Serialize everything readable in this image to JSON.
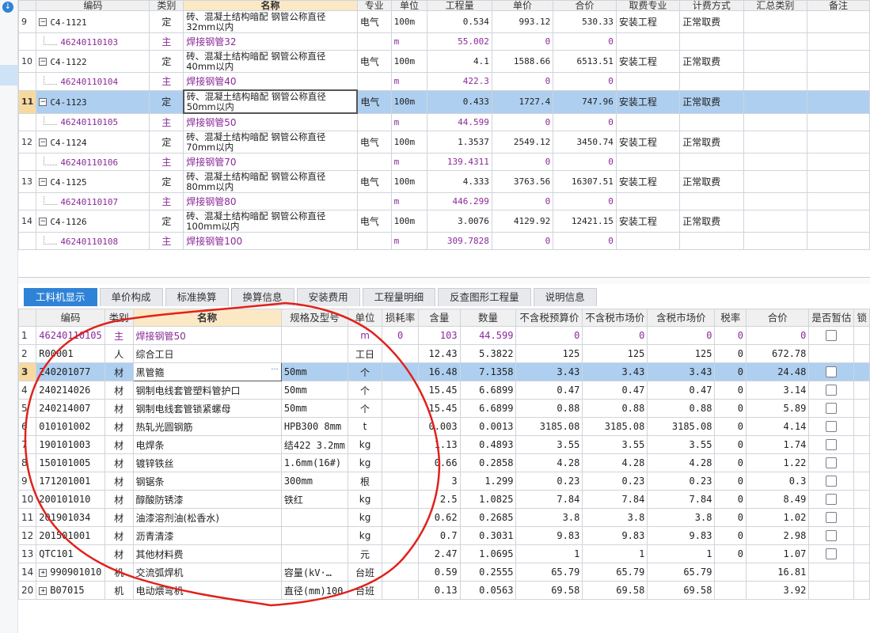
{
  "top_table": {
    "headers": [
      "",
      "编码",
      "类别",
      "名称",
      "专业",
      "单位",
      "工程量",
      "单价",
      "合价",
      "取费专业",
      "计费方式",
      "汇总类别",
      "备注"
    ],
    "rows": [
      {
        "no": "9",
        "code": "C4-1121",
        "type": "定",
        "name": "砖、混凝土结构暗配 钢管公称直径32mm以内",
        "spec": "电气",
        "unit": "100m",
        "qty": "0.534",
        "price": "993.12",
        "total": "530.33",
        "fee": "安装工程",
        "method": "正常取费",
        "sub": {
          "code": "46240110103",
          "type": "主",
          "name": "焊接钢管32",
          "unit": "m",
          "qty": "55.002",
          "price": "0",
          "total": "0"
        }
      },
      {
        "no": "10",
        "code": "C4-1122",
        "type": "定",
        "name": "砖、混凝土结构暗配 钢管公称直径40mm以内",
        "spec": "电气",
        "unit": "100m",
        "qty": "4.1",
        "price": "1588.66",
        "total": "6513.51",
        "fee": "安装工程",
        "method": "正常取费",
        "sub": {
          "code": "46240110104",
          "type": "主",
          "name": "焊接钢管40",
          "unit": "m",
          "qty": "422.3",
          "price": "0",
          "total": "0"
        }
      },
      {
        "no": "11",
        "code": "C4-1123",
        "type": "定",
        "name": "砖、混凝土结构暗配 钢管公称直径50mm以内",
        "spec": "电气",
        "unit": "100m",
        "qty": "0.433",
        "price": "1727.4",
        "total": "747.96",
        "fee": "安装工程",
        "method": "正常取费",
        "selected": true,
        "sub": {
          "code": "46240110105",
          "type": "主",
          "name": "焊接钢管50",
          "unit": "m",
          "qty": "44.599",
          "price": "0",
          "total": "0"
        }
      },
      {
        "no": "12",
        "code": "C4-1124",
        "type": "定",
        "name": "砖、混凝土结构暗配 钢管公称直径70mm以内",
        "spec": "电气",
        "unit": "100m",
        "qty": "1.3537",
        "price": "2549.12",
        "total": "3450.74",
        "fee": "安装工程",
        "method": "正常取费",
        "sub": {
          "code": "46240110106",
          "type": "主",
          "name": "焊接钢管70",
          "unit": "m",
          "qty": "139.4311",
          "price": "0",
          "total": "0"
        }
      },
      {
        "no": "13",
        "code": "C4-1125",
        "type": "定",
        "name": "砖、混凝土结构暗配 钢管公称直径80mm以内",
        "spec": "电气",
        "unit": "100m",
        "qty": "4.333",
        "price": "3763.56",
        "total": "16307.51",
        "fee": "安装工程",
        "method": "正常取费",
        "sub": {
          "code": "46240110107",
          "type": "主",
          "name": "焊接钢管80",
          "unit": "m",
          "qty": "446.299",
          "price": "0",
          "total": "0"
        }
      },
      {
        "no": "14",
        "code": "C4-1126",
        "type": "定",
        "name": "砖、混凝土结构暗配 钢管公称直径100mm以内",
        "spec": "电气",
        "unit": "100m",
        "qty": "3.0076",
        "price": "4129.92",
        "total": "12421.15",
        "fee": "安装工程",
        "method": "正常取费",
        "sub": {
          "code": "46240110108",
          "type": "主",
          "name": "焊接钢管100",
          "unit": "m",
          "qty": "309.7828",
          "price": "0",
          "total": "0"
        }
      }
    ]
  },
  "tabs": [
    "工料机显示",
    "单价构成",
    "标准换算",
    "换算信息",
    "安装费用",
    "工程量明细",
    "反查图形工程量",
    "说明信息"
  ],
  "bottom_table": {
    "headers": [
      "",
      "编码",
      "类别",
      "名称",
      "规格及型号",
      "单位",
      "损耗率",
      "含量",
      "数量",
      "不含税预算价",
      "不含税市场价",
      "含税市场价",
      "税率",
      "合价",
      "是否暂估",
      "锁"
    ],
    "rows": [
      {
        "no": "1",
        "code": "46240110105",
        "type": "主",
        "name": "焊接钢管50",
        "spec": "",
        "unit": "m",
        "loss": "0",
        "content": "103",
        "qty": "44.599",
        "p1": "0",
        "p2": "0",
        "p3": "0",
        "tax": "0",
        "total": "0",
        "check": true,
        "purple": true
      },
      {
        "no": "2",
        "code": "R00001",
        "type": "人",
        "name": "综合工日",
        "spec": "",
        "unit": "工日",
        "loss": "",
        "content": "12.43",
        "qty": "5.3822",
        "p1": "125",
        "p2": "125",
        "p3": "125",
        "tax": "0",
        "total": "672.78",
        "check": false
      },
      {
        "no": "3",
        "code": "240201077",
        "type": "材",
        "name": "黑管箍",
        "spec": "50mm",
        "unit": "个",
        "loss": "",
        "content": "16.48",
        "qty": "7.1358",
        "p1": "3.43",
        "p2": "3.43",
        "p3": "3.43",
        "tax": "0",
        "total": "24.48",
        "check": true,
        "selected": true
      },
      {
        "no": "4",
        "code": "240214026",
        "type": "材",
        "name": "钢制电线套管塑料管护口",
        "spec": "50mm",
        "unit": "个",
        "loss": "",
        "content": "15.45",
        "qty": "6.6899",
        "p1": "0.47",
        "p2": "0.47",
        "p3": "0.47",
        "tax": "0",
        "total": "3.14",
        "check": true
      },
      {
        "no": "5",
        "code": "240214007",
        "type": "材",
        "name": "钢制电线套管锁紧螺母",
        "spec": "50mm",
        "unit": "个",
        "loss": "",
        "content": "15.45",
        "qty": "6.6899",
        "p1": "0.88",
        "p2": "0.88",
        "p3": "0.88",
        "tax": "0",
        "total": "5.89",
        "check": true
      },
      {
        "no": "6",
        "code": "010101002",
        "type": "材",
        "name": "热轧光圆钢筋",
        "spec": "HPB300 8mm",
        "unit": "t",
        "loss": "",
        "content": "0.003",
        "qty": "0.0013",
        "p1": "3185.08",
        "p2": "3185.08",
        "p3": "3185.08",
        "tax": "0",
        "total": "4.14",
        "check": true
      },
      {
        "no": "7",
        "code": "190101003",
        "type": "材",
        "name": "电焊条",
        "spec": "结422 3.2mm",
        "unit": "kg",
        "loss": "",
        "content": "1.13",
        "qty": "0.4893",
        "p1": "3.55",
        "p2": "3.55",
        "p3": "3.55",
        "tax": "0",
        "total": "1.74",
        "check": true
      },
      {
        "no": "8",
        "code": "150101005",
        "type": "材",
        "name": "镀锌铁丝",
        "spec": "1.6mm(16#)",
        "unit": "kg",
        "loss": "",
        "content": "0.66",
        "qty": "0.2858",
        "p1": "4.28",
        "p2": "4.28",
        "p3": "4.28",
        "tax": "0",
        "total": "1.22",
        "check": true
      },
      {
        "no": "9",
        "code": "171201001",
        "type": "材",
        "name": "钢锯条",
        "spec": "300mm",
        "unit": "根",
        "loss": "",
        "content": "3",
        "qty": "1.299",
        "p1": "0.23",
        "p2": "0.23",
        "p3": "0.23",
        "tax": "0",
        "total": "0.3",
        "check": true
      },
      {
        "no": "10",
        "code": "200101010",
        "type": "材",
        "name": "醇酸防锈漆",
        "spec": "铁红",
        "unit": "kg",
        "loss": "",
        "content": "2.5",
        "qty": "1.0825",
        "p1": "7.84",
        "p2": "7.84",
        "p3": "7.84",
        "tax": "0",
        "total": "8.49",
        "check": true
      },
      {
        "no": "11",
        "code": "201901034",
        "type": "材",
        "name": "油漆溶剂油(松香水)",
        "spec": "",
        "unit": "kg",
        "loss": "",
        "content": "0.62",
        "qty": "0.2685",
        "p1": "3.8",
        "p2": "3.8",
        "p3": "3.8",
        "tax": "0",
        "total": "1.02",
        "check": true
      },
      {
        "no": "12",
        "code": "201501001",
        "type": "材",
        "name": "沥青清漆",
        "spec": "",
        "unit": "kg",
        "loss": "",
        "content": "0.7",
        "qty": "0.3031",
        "p1": "9.83",
        "p2": "9.83",
        "p3": "9.83",
        "tax": "0",
        "total": "2.98",
        "check": true
      },
      {
        "no": "13",
        "code": "QTC101",
        "type": "材",
        "name": "其他材料费",
        "spec": "",
        "unit": "元",
        "loss": "",
        "content": "2.47",
        "qty": "1.0695",
        "p1": "1",
        "p2": "1",
        "p3": "1",
        "tax": "0",
        "total": "1.07",
        "check": true
      },
      {
        "no": "14",
        "code": "990901010",
        "type": "机",
        "name": "交流弧焊机",
        "spec": "容量(kV·…",
        "unit": "台班",
        "loss": "",
        "content": "0.59",
        "qty": "0.2555",
        "p1": "65.79",
        "p2": "65.79",
        "p3": "65.79",
        "tax": "",
        "total": "16.81",
        "check": false,
        "expand": true
      },
      {
        "no": "20",
        "code": "B07015",
        "type": "机",
        "name": "电动煨弯机",
        "spec": "直径(mm)100",
        "unit": "台班",
        "loss": "",
        "content": "0.13",
        "qty": "0.0563",
        "p1": "69.58",
        "p2": "69.58",
        "p3": "69.58",
        "tax": "",
        "total": "3.92",
        "check": false,
        "expand": true
      }
    ]
  },
  "colors": {
    "accent": "#2f83d6",
    "selected_row": "#aecff0",
    "purple_text": "#8a2a99",
    "annotation": "#e0211b"
  },
  "icons": {
    "left_toolbar": "download-icon",
    "tree_toggle": "collapse-icon"
  }
}
